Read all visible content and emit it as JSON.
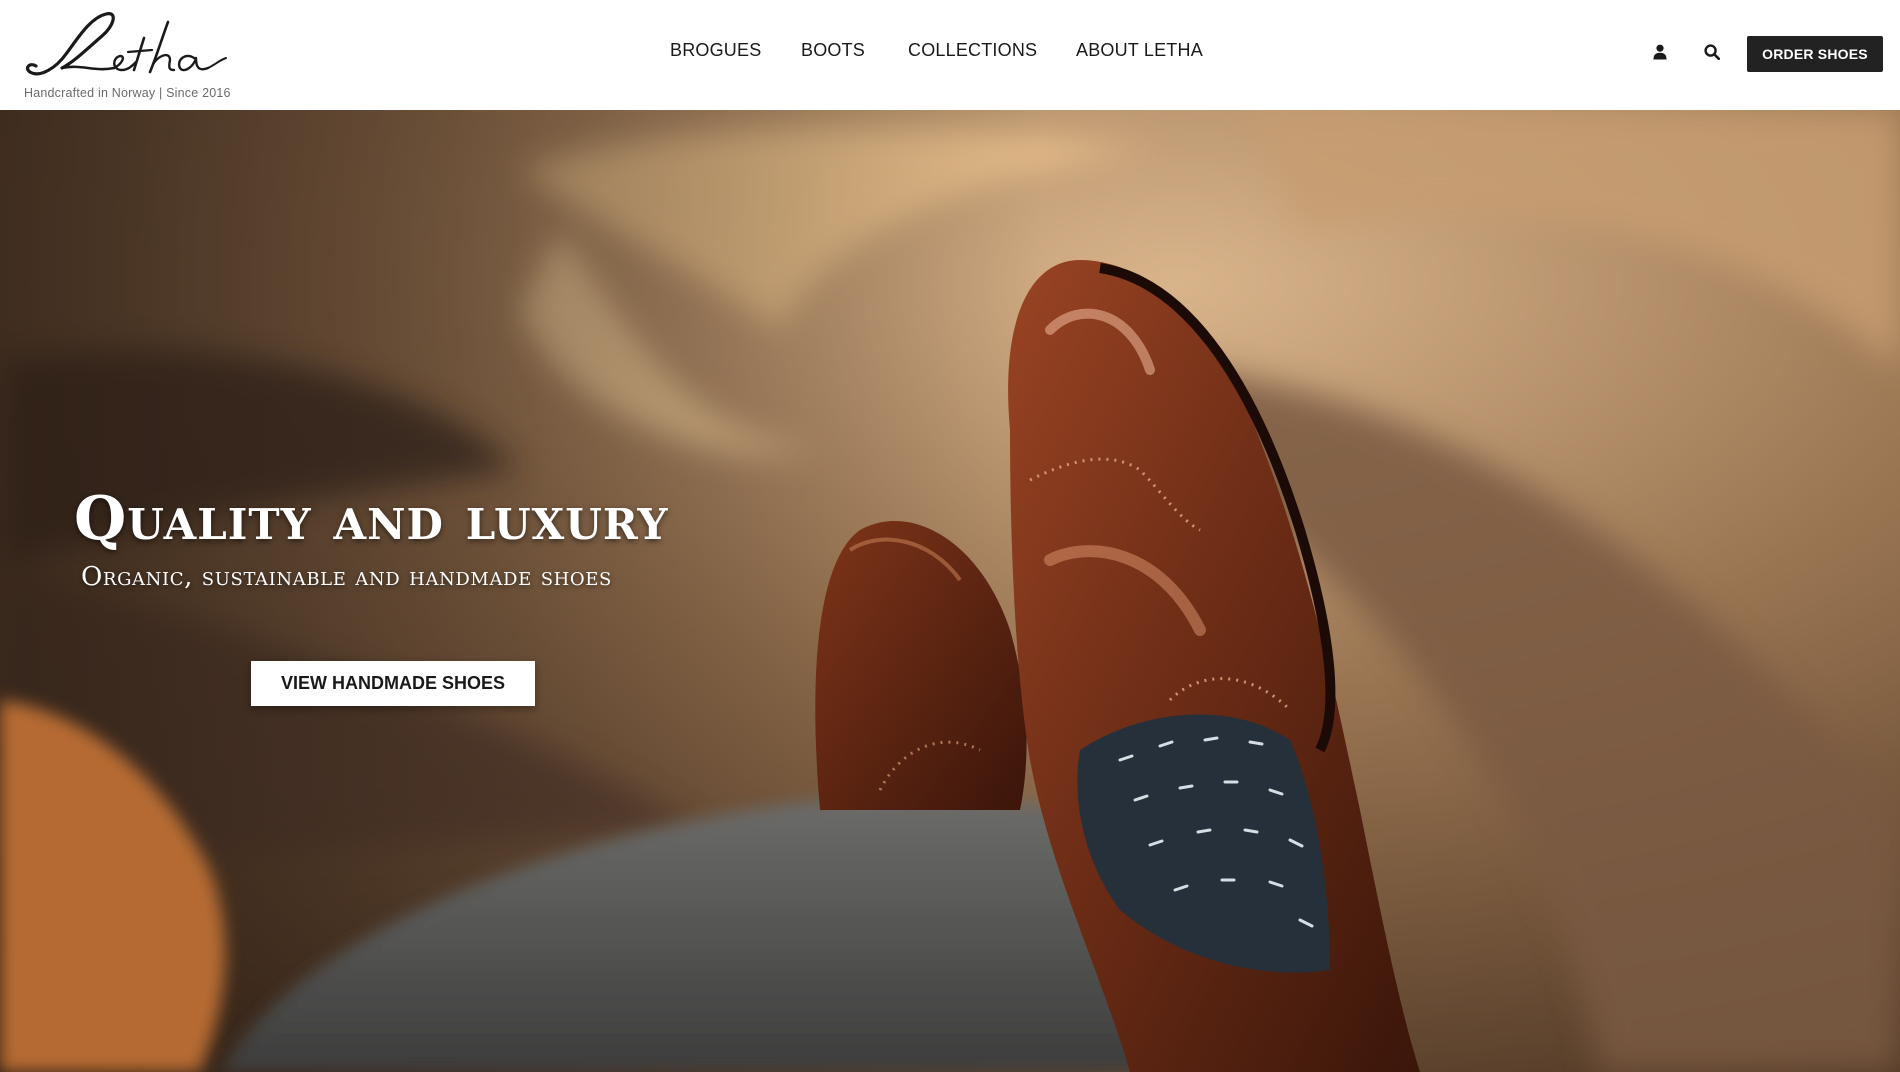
{
  "brand": {
    "logo_text": "Letha",
    "tagline": "Handcrafted in Norway | Since 2016"
  },
  "nav": {
    "items": [
      {
        "label": "BROGUES"
      },
      {
        "label": "BOOTS"
      },
      {
        "label": "COLLECTIONS"
      },
      {
        "label": "ABOUT LETHA"
      }
    ]
  },
  "header_actions": {
    "account_icon": "user-icon",
    "search_icon": "search-icon",
    "order_label": "ORDER SHOES"
  },
  "hero": {
    "title": "Quality and luxury",
    "subtitle": "Organic, sustainable and handmade shoes",
    "cta_label": "VIEW HANDMADE SHOES",
    "image_subject": "brown-leather-brogue-shoes-crossed-on-carpet"
  },
  "colors": {
    "header_bg": "#ffffff",
    "order_button_bg": "#222222",
    "hero_text": "#ffffff",
    "leather_brown": "#6e2d16"
  }
}
